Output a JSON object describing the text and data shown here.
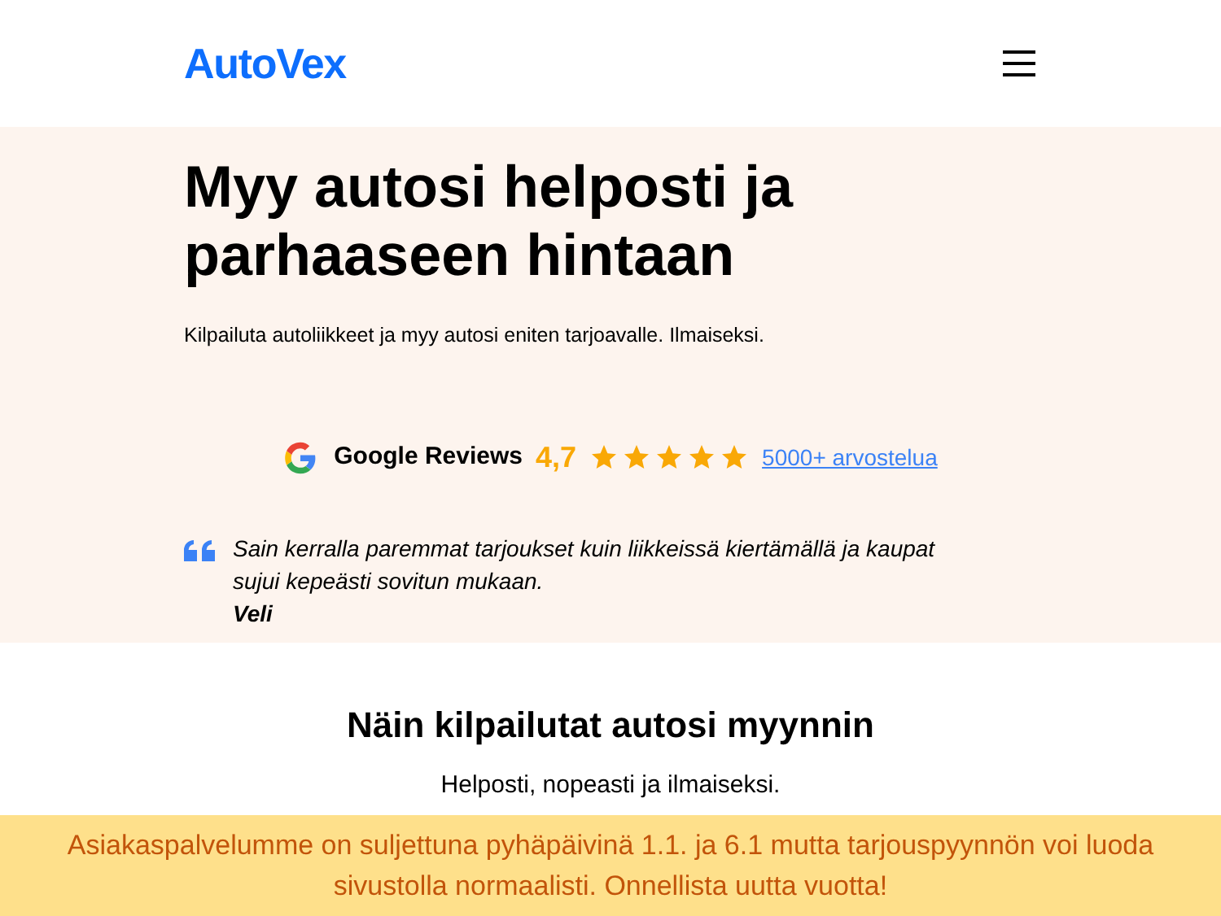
{
  "header": {
    "logo": "AutoVex"
  },
  "hero": {
    "title": "Myy autosi helposti ja parhaaseen hintaan",
    "subtitle": "Kilpailuta autoliikkeet ja myy autosi eniten tarjoavalle. Ilmaiseksi.",
    "reviews": {
      "label": "Google Reviews",
      "score": "4,7",
      "stars": 5,
      "link": "5000+ arvostelua"
    },
    "testimonial": {
      "quote": "Sain kerralla paremmat tarjoukset kuin liikkeissä kiertämällä ja kaupat sujui kepeästi sovitun mukaan.",
      "author": "Veli"
    }
  },
  "section": {
    "title": "Näin kilpailutat autosi myynnin",
    "subtitle": "Helposti, nopeasti ja ilmaiseksi."
  },
  "notice": "Asiakaspalvelumme on suljettuna pyhäpäivinä 1.1. ja 6.1 mutta tarjouspyynnön voi luoda sivustolla normaalisti. Onnellista uutta vuotta!"
}
